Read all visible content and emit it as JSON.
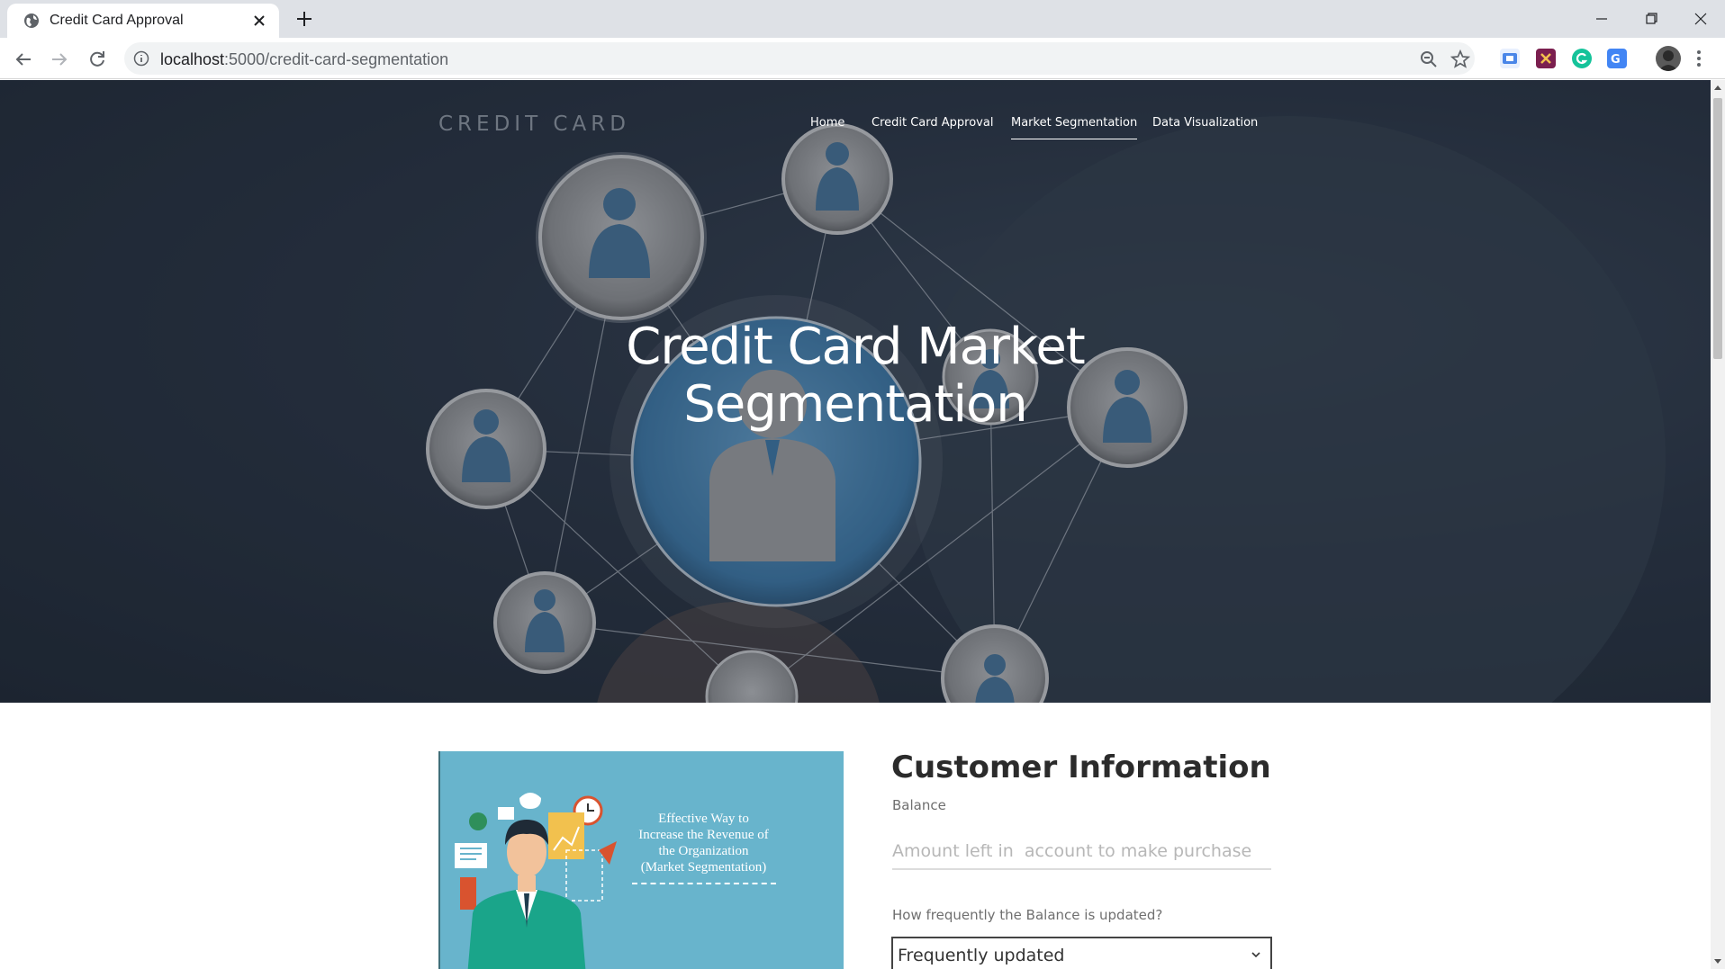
{
  "browser": {
    "tab_title": "Credit Card Approval",
    "url_host": "localhost",
    "url_path": ":5000/credit-card-segmentation"
  },
  "site": {
    "brand": "CREDIT CARD",
    "nav": [
      {
        "label": "Home",
        "active": false
      },
      {
        "label": "Credit Card Approval",
        "active": false
      },
      {
        "label": "Market Segmentation",
        "active": true
      },
      {
        "label": "Data Visualization",
        "active": false
      }
    ],
    "hero_title_line1": "Credit Card Market",
    "hero_title_line2": "Segmentation"
  },
  "promo": {
    "lines": [
      "Effective Way to",
      "Increase the Revenue of",
      "the Organization",
      "(Market Segmentation)"
    ]
  },
  "form": {
    "title": "Customer Information",
    "balance_label": "Balance",
    "balance_placeholder": "Amount left in  account to make purchase",
    "balance_freq_label": "How frequently the Balance is updated?",
    "balance_freq_value": "Frequently updated"
  },
  "colors": {
    "accent_blue": "#4a86b3",
    "promo_bg": "#68b4cc",
    "hero_bg": "#1e2631"
  }
}
